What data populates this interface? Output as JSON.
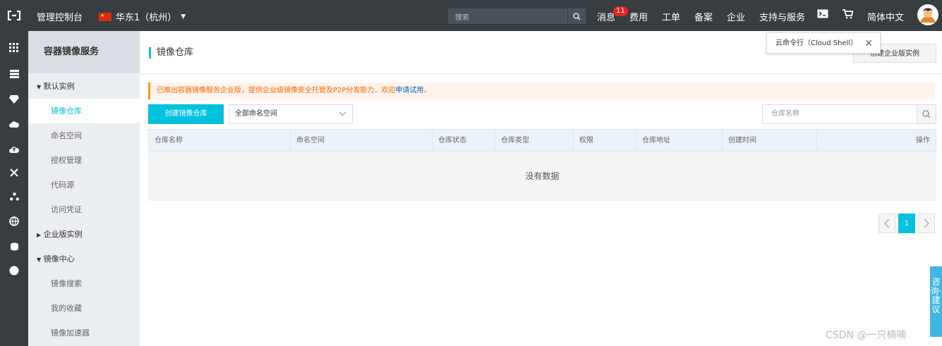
{
  "topbar": {
    "console": "管理控制台",
    "region": "华东1（杭州）",
    "search_placeholder": "搜索",
    "messages": "消息",
    "messages_badge": "11",
    "billing": "费用",
    "tickets": "工单",
    "icp": "备案",
    "enterprise": "企业",
    "support": "支持与服务",
    "language": "简体中文"
  },
  "tooltip": {
    "text": "云命令行（Cloud Shell）",
    "close": "✕"
  },
  "sidebar": {
    "title": "容器镜像服务",
    "items": [
      {
        "label": "默认实例"
      },
      {
        "label": "镜像仓库"
      },
      {
        "label": "命名空间"
      },
      {
        "label": "授权管理"
      },
      {
        "label": "代码源"
      },
      {
        "label": "访问凭证"
      },
      {
        "label": "企业版实例"
      },
      {
        "label": "镜像中心"
      },
      {
        "label": "镜像搜索"
      },
      {
        "label": "我的收藏"
      },
      {
        "label": "镜像加速器"
      }
    ]
  },
  "main": {
    "title": "镜像仓库",
    "enterprise_button": "创建企业版实例",
    "notice_text": "已推出容器镜像服务企业版，提供企业级镜像安全托管及P2P分发能力，欢迎",
    "notice_link": "申请试用",
    "notice_end": "。",
    "create_button": "创建镜像仓库",
    "namespace_select": "全部命名空间",
    "search_placeholder": "仓库名称",
    "columns": [
      "仓库名称",
      "命名空间",
      "仓库状态",
      "仓库类型",
      "权限",
      "仓库地址",
      "创建时间",
      "操作"
    ],
    "empty": "没有数据",
    "current_page": "1"
  },
  "consult": "咨询·建议",
  "watermark": "CSDN @一只楠喃"
}
